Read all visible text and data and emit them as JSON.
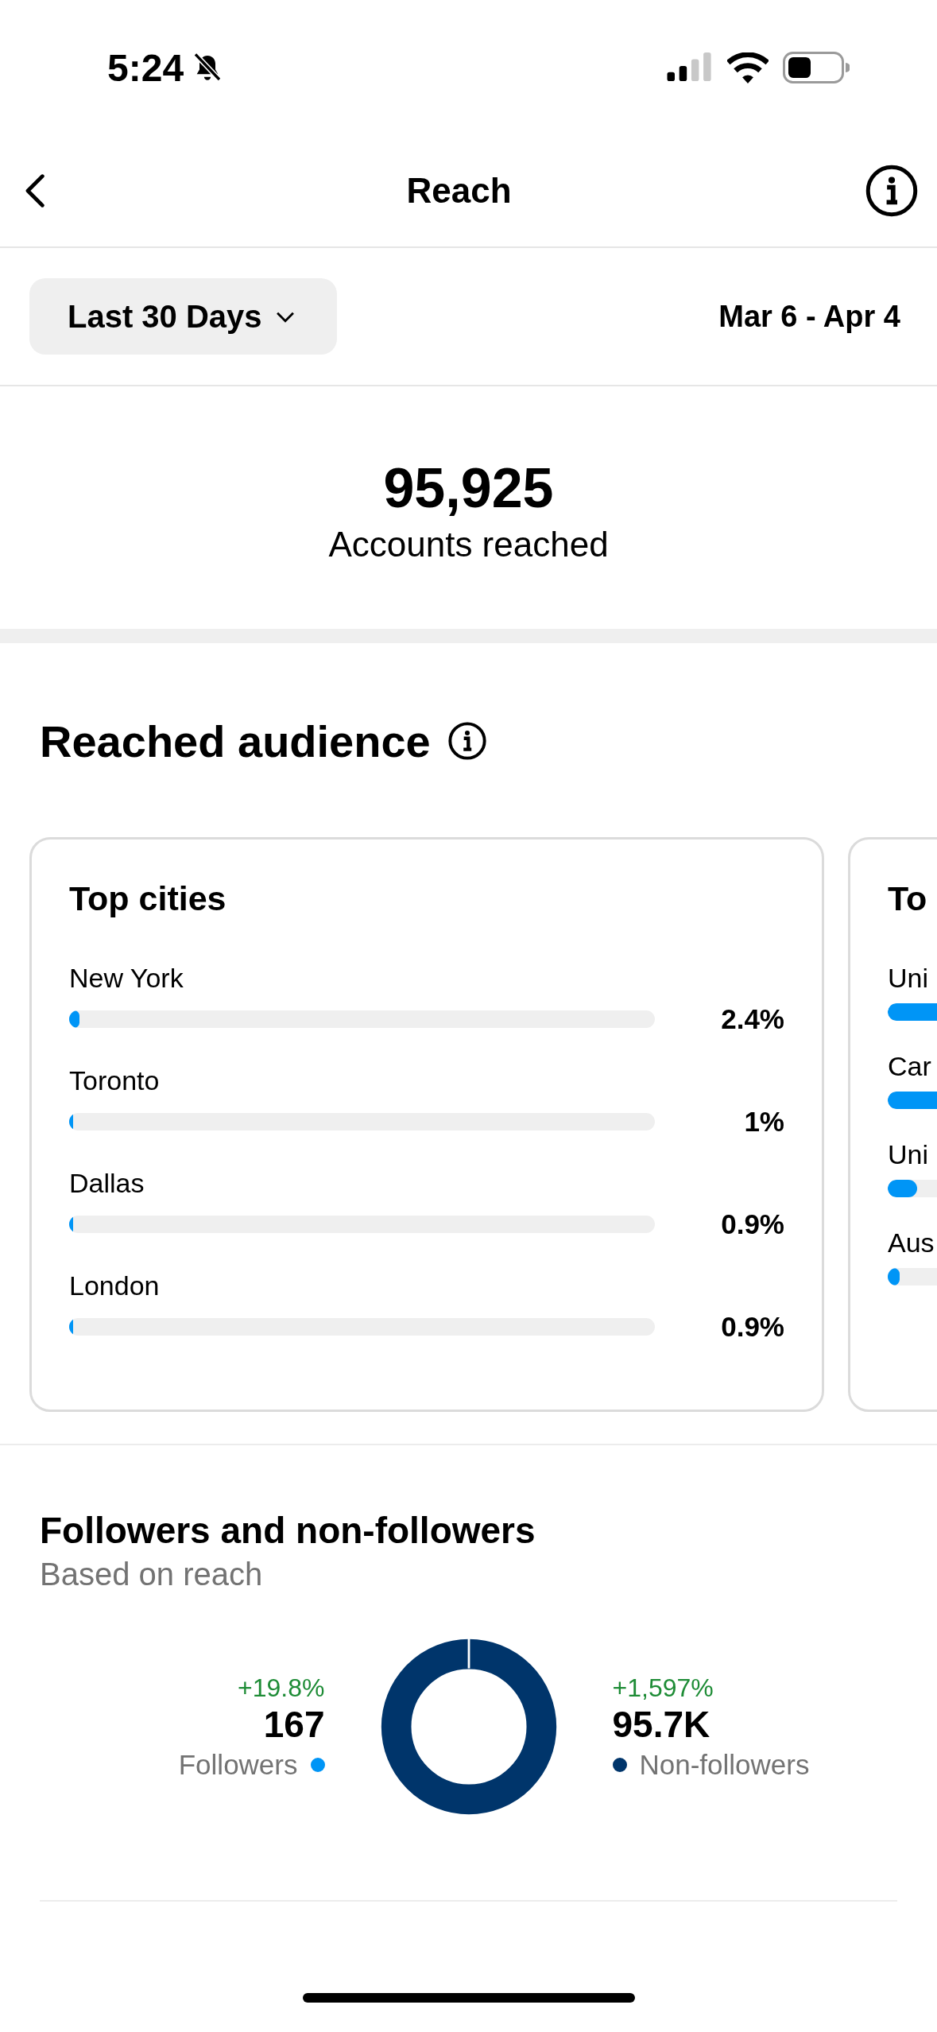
{
  "status_bar": {
    "time": "5:24"
  },
  "header": {
    "title": "Reach"
  },
  "filter": {
    "period": "Last 30 Days",
    "date_range": "Mar 6 - Apr 4"
  },
  "summary": {
    "value": "95,925",
    "label": "Accounts reached"
  },
  "audience": {
    "title": "Reached audience",
    "cards": [
      {
        "title": "Top cities",
        "rows": [
          {
            "label": "New York",
            "level": 0.018,
            "value": "2.4%"
          },
          {
            "label": "Toronto",
            "level": 0.006,
            "value": "1%"
          },
          {
            "label": "Dallas",
            "level": 0.006,
            "value": "0.9%"
          },
          {
            "label": "London",
            "level": 0.006,
            "value": "0.9%"
          }
        ]
      },
      {
        "title": "To",
        "rows": [
          {
            "label": "Uni",
            "level": 0.5
          },
          {
            "label": "Car",
            "level": 0.17
          },
          {
            "label": "Uni",
            "level": 0.05
          },
          {
            "label": "Aus",
            "level": 0.02
          }
        ]
      }
    ]
  },
  "followers": {
    "title": "Followers and non-followers",
    "subtitle": "Based on reach",
    "groups": [
      {
        "change": "+19.8%",
        "value": "167",
        "label": "Followers",
        "color": "#0095f6"
      },
      {
        "change": "+1,597%",
        "value": "95.7K",
        "label": "Non-followers",
        "color": "#00356b"
      }
    ]
  }
}
